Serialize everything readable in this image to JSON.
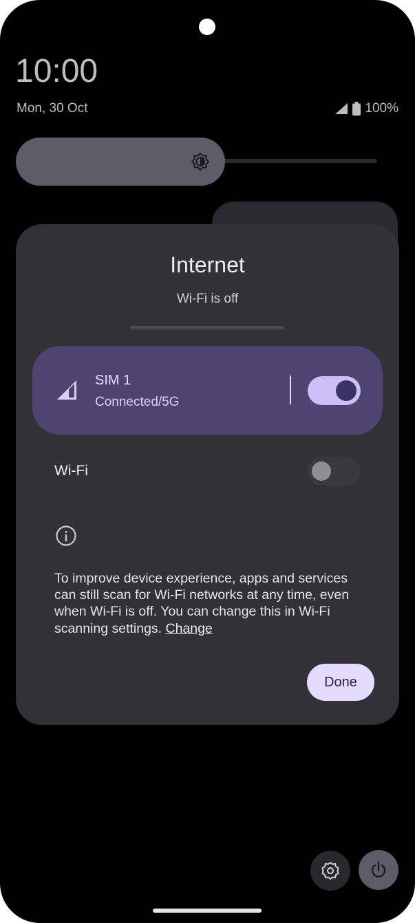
{
  "status_bar": {
    "time": "10:00",
    "date": "Mon, 30 Oct",
    "battery": "100%"
  },
  "dialog": {
    "title": "Internet",
    "subtitle": "Wi-Fi is off",
    "sim": {
      "name": "SIM 1",
      "status": "Connected/5G",
      "enabled": true
    },
    "wifi": {
      "label": "Wi-Fi",
      "enabled": false
    },
    "info_text": "To improve device experience, apps and services can still scan for Wi-Fi networks at any time, even when Wi-Fi is off. You can change this in Wi-Fi scanning settings.",
    "info_link": "Change",
    "done_label": "Done"
  },
  "colors": {
    "sim_card": "#4d4472",
    "toggle_on": "#cbbff7",
    "dialog_bg": "#323137",
    "done_bg": "#e4dcfc"
  }
}
